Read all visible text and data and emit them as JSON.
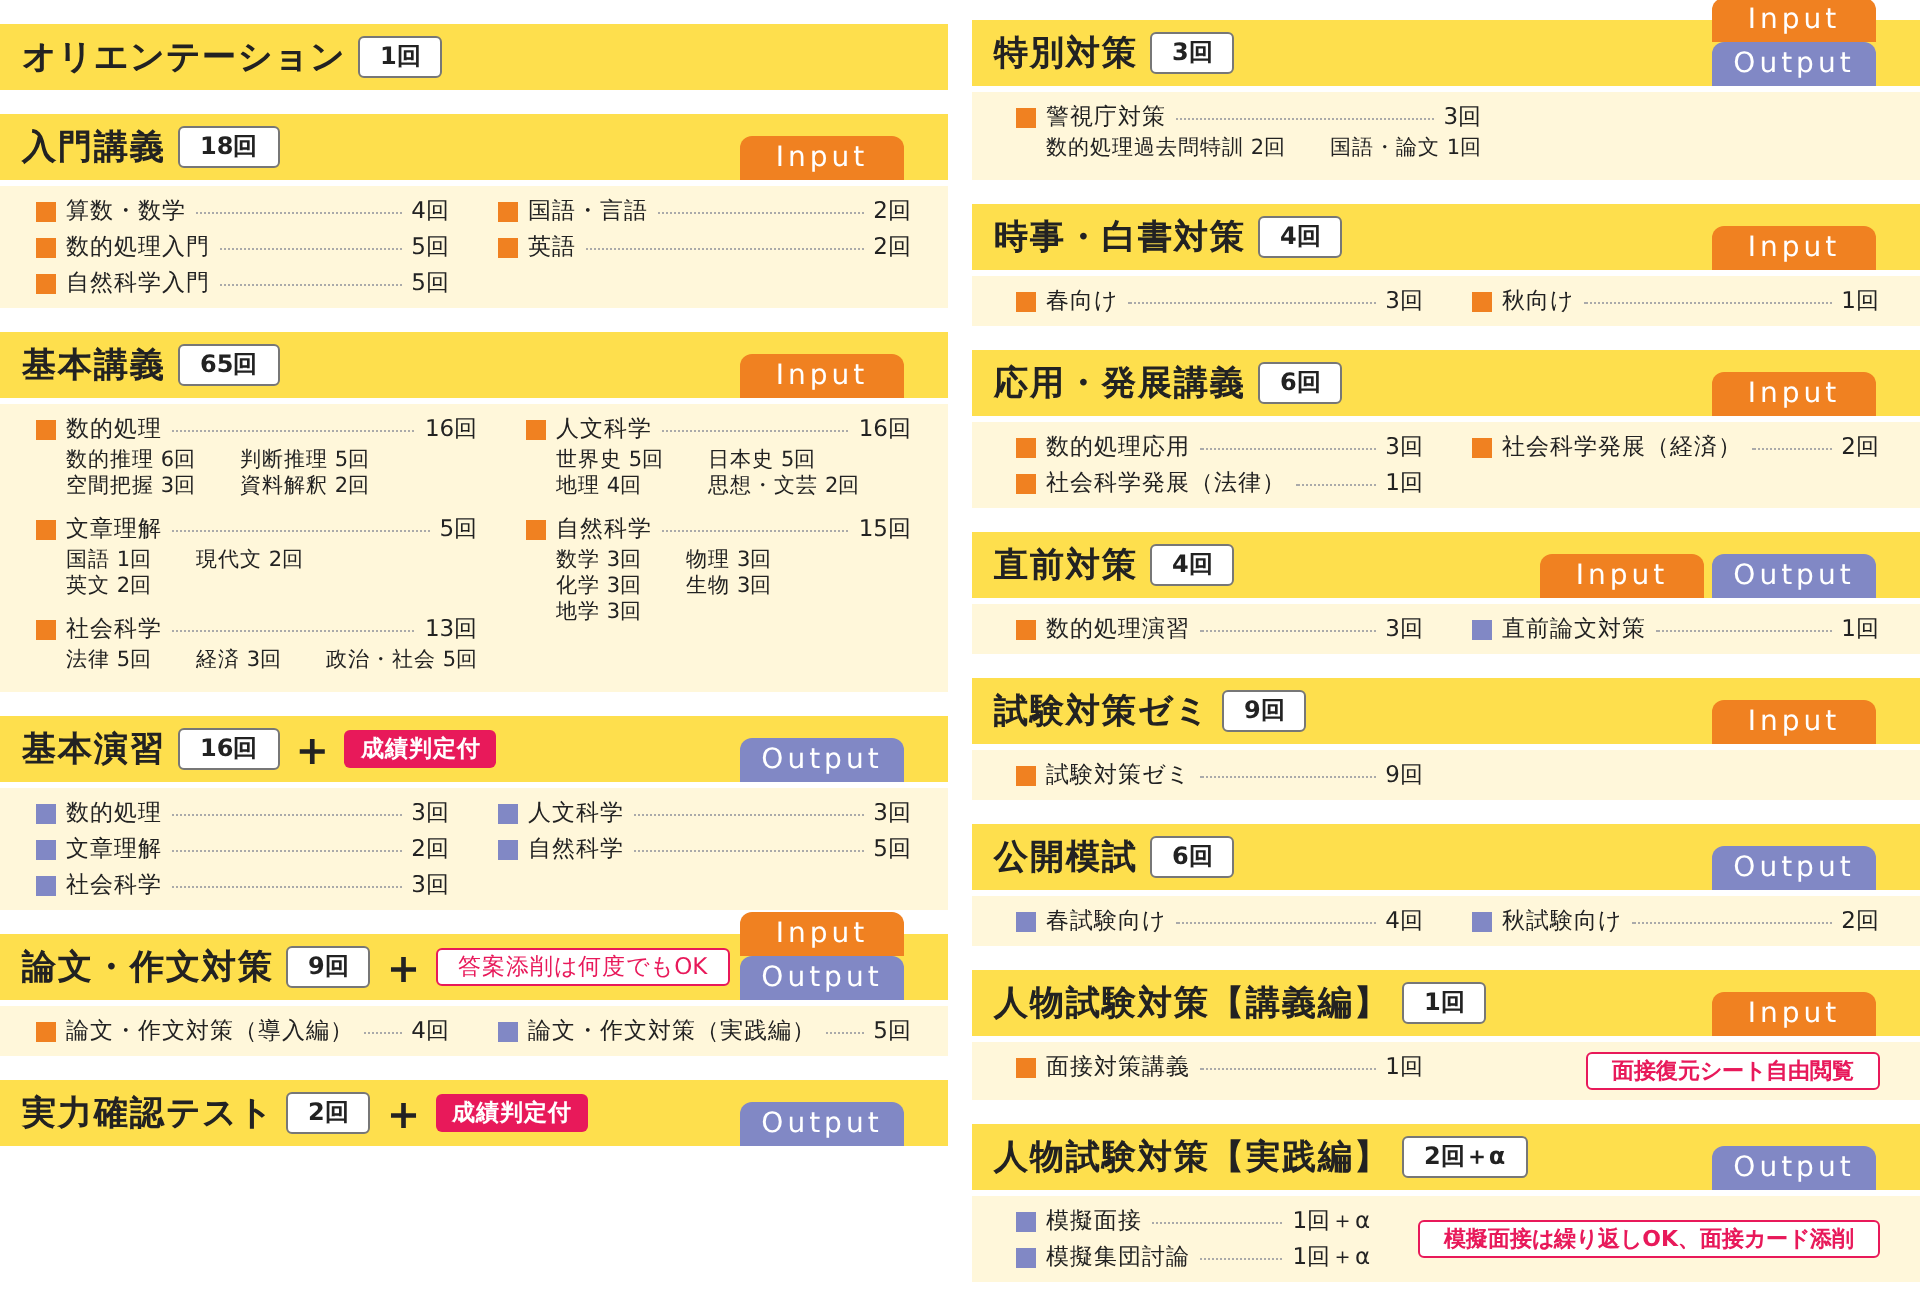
{
  "left": [
    {
      "title": "オリエンテーション",
      "count": "1回"
    },
    {
      "title": "入門講義",
      "count": "18回",
      "tags": [
        {
          "label": "Input",
          "kind": "input"
        }
      ],
      "columns": [
        [
          {
            "kind": "input",
            "label": "算数・数学",
            "count": "4回"
          },
          {
            "kind": "input",
            "label": "数的処理入門",
            "count": "5回"
          },
          {
            "kind": "input",
            "label": "自然科学入門",
            "count": "5回"
          }
        ],
        [
          {
            "kind": "input",
            "label": "国語・言語",
            "count": "2回"
          },
          {
            "kind": "input",
            "label": "英語",
            "count": "2回"
          }
        ]
      ]
    },
    {
      "title": "基本講義",
      "count": "65回",
      "tags": [
        {
          "label": "Input",
          "kind": "input"
        }
      ],
      "columns": [
        [
          {
            "kind": "input",
            "label": "数的処理",
            "count": "16回",
            "details": [
              [
                "数的推理 6回",
                "判断推理 5回"
              ],
              [
                "空間把握 3回",
                "資料解釈 2回"
              ]
            ]
          },
          {
            "kind": "input",
            "label": "文章理解",
            "count": "5回",
            "details": [
              [
                "国語 1回",
                "現代文 2回"
              ],
              [
                "英文 2回"
              ]
            ]
          },
          {
            "kind": "input",
            "label": "社会科学",
            "count": "13回",
            "details": [
              [
                "法律 5回",
                "経済 3回",
                "政治・社会 5回"
              ]
            ]
          }
        ],
        [
          {
            "kind": "input",
            "label": "人文科学",
            "count": "16回",
            "details": [
              [
                "世界史 5回",
                "日本史 5回"
              ],
              [
                "地理 4回",
                "思想・文芸 2回"
              ]
            ]
          },
          {
            "kind": "input",
            "label": "自然科学",
            "count": "15回",
            "details": [
              [
                "数学 3回",
                "物理 3回"
              ],
              [
                "化学 3回",
                "生物 3回"
              ],
              [
                "地学 3回"
              ]
            ]
          }
        ]
      ]
    },
    {
      "title": "基本演習",
      "count": "16回",
      "extras": [
        {
          "kind": "plus",
          "text": "+"
        },
        {
          "kind": "badge",
          "text": "成績判定付"
        }
      ],
      "tags": [
        {
          "label": "Output",
          "kind": "output"
        }
      ],
      "columns": [
        [
          {
            "kind": "output",
            "label": "数的処理",
            "count": "3回"
          },
          {
            "kind": "output",
            "label": "文章理解",
            "count": "2回"
          },
          {
            "kind": "output",
            "label": "社会科学",
            "count": "3回"
          }
        ],
        [
          {
            "kind": "output",
            "label": "人文科学",
            "count": "3回"
          },
          {
            "kind": "output",
            "label": "自然科学",
            "count": "5回"
          }
        ]
      ]
    },
    {
      "title": "論文・作文対策",
      "count": "9回",
      "extras": [
        {
          "kind": "plus",
          "text": "+"
        },
        {
          "kind": "note",
          "text": "答案添削は何度でもOK"
        }
      ],
      "tags": [
        {
          "label": "Input",
          "kind": "input"
        },
        {
          "label": "Output",
          "kind": "output"
        }
      ],
      "stack": true,
      "columns": [
        [
          {
            "kind": "input",
            "label": "論文・作文対策（導入編）",
            "count": "4回"
          }
        ],
        [
          {
            "kind": "output",
            "label": "論文・作文対策（実践編）",
            "count": "5回"
          }
        ]
      ]
    },
    {
      "title": "実力確認テスト",
      "count": "2回",
      "extras": [
        {
          "kind": "plus",
          "text": "+"
        },
        {
          "kind": "badge",
          "text": "成績判定付"
        }
      ],
      "tags": [
        {
          "label": "Output",
          "kind": "output"
        }
      ]
    }
  ],
  "right": [
    {
      "title": "特別対策",
      "count": "3回",
      "tags": [
        {
          "label": "Input",
          "kind": "input"
        },
        {
          "label": "Output",
          "kind": "output"
        }
      ],
      "stack": true,
      "columns": [
        [
          {
            "kind": "input",
            "label": "警視庁対策",
            "count": "3回",
            "details": [
              [
                "数的処理過去問特訓 2回",
                "国語・論文 1回"
              ]
            ]
          }
        ],
        []
      ]
    },
    {
      "title": "時事・白書対策",
      "count": "4回",
      "tags": [
        {
          "label": "Input",
          "kind": "input"
        }
      ],
      "columns": [
        [
          {
            "kind": "input",
            "label": "春向け",
            "count": "3回"
          }
        ],
        [
          {
            "kind": "input",
            "label": "秋向け",
            "count": "1回"
          }
        ]
      ]
    },
    {
      "title": "応用・発展講義",
      "count": "6回",
      "tags": [
        {
          "label": "Input",
          "kind": "input"
        }
      ],
      "columns": [
        [
          {
            "kind": "input",
            "label": "数的処理応用",
            "count": "3回"
          },
          {
            "kind": "input",
            "label": "社会科学発展（法律）",
            "count": "1回"
          }
        ],
        [
          {
            "kind": "input",
            "label": "社会科学発展（経済）",
            "count": "2回"
          }
        ]
      ]
    },
    {
      "title": "直前対策",
      "count": "4回",
      "tags": [
        {
          "label": "Input",
          "kind": "input"
        },
        {
          "label": "Output",
          "kind": "output"
        }
      ],
      "stack": false,
      "columns": [
        [
          {
            "kind": "input",
            "label": "数的処理演習",
            "count": "3回"
          }
        ],
        [
          {
            "kind": "output",
            "label": "直前論文対策",
            "count": "1回"
          }
        ]
      ]
    },
    {
      "title": "試験対策ゼミ",
      "count": "9回",
      "tags": [
        {
          "label": "Input",
          "kind": "input"
        }
      ],
      "columns": [
        [
          {
            "kind": "input",
            "label": "試験対策ゼミ",
            "count": "9回"
          }
        ],
        []
      ]
    },
    {
      "title": "公開模試",
      "count": "6回",
      "tags": [
        {
          "label": "Output",
          "kind": "output"
        }
      ],
      "columns": [
        [
          {
            "kind": "output",
            "label": "春試験向け",
            "count": "4回"
          }
        ],
        [
          {
            "kind": "output",
            "label": "秋試験向け",
            "count": "2回"
          }
        ]
      ]
    },
    {
      "title": "人物試験対策【講義編】",
      "count": "1回",
      "tags": [
        {
          "label": "Input",
          "kind": "input"
        }
      ],
      "columns": [
        [
          {
            "kind": "input",
            "label": "面接対策講義",
            "count": "1回"
          }
        ],
        [
          {
            "kind": "note",
            "text": "面接復元シート自由閲覧"
          }
        ]
      ]
    },
    {
      "title": "人物試験対策【実践編】",
      "count": "2回＋α",
      "tags": [
        {
          "label": "Output",
          "kind": "output"
        }
      ],
      "columns": [
        [
          {
            "kind": "output",
            "label": "模擬面接",
            "count": "1回＋α"
          },
          {
            "kind": "output",
            "label": "模擬集団討論",
            "count": "1回＋α"
          }
        ],
        [
          {
            "kind": "note",
            "text": "模擬面接は繰り返しOK、面接カード添削"
          }
        ]
      ]
    }
  ]
}
